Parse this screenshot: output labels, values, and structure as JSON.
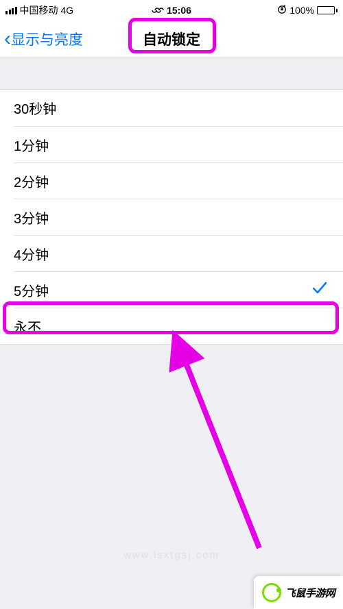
{
  "status": {
    "carrier": "中国移动",
    "network": "4G",
    "time": "15:06",
    "battery_pct": "100%",
    "orientation_lock": "⊙"
  },
  "nav": {
    "back_label": "显示与亮度",
    "title": "自动锁定"
  },
  "options": [
    {
      "label": "30秒钟",
      "selected": false
    },
    {
      "label": "1分钟",
      "selected": false
    },
    {
      "label": "2分钟",
      "selected": false
    },
    {
      "label": "3分钟",
      "selected": false
    },
    {
      "label": "4分钟",
      "selected": false
    },
    {
      "label": "5分钟",
      "selected": true
    },
    {
      "label": "永不",
      "selected": false
    }
  ],
  "watermark": "www.lsxtgsj.com",
  "logo": {
    "text": "飞鼠手游网"
  },
  "annotation": {
    "highlight_title": true,
    "highlight_option_index": 6,
    "arrow_color": "#e600e6"
  }
}
